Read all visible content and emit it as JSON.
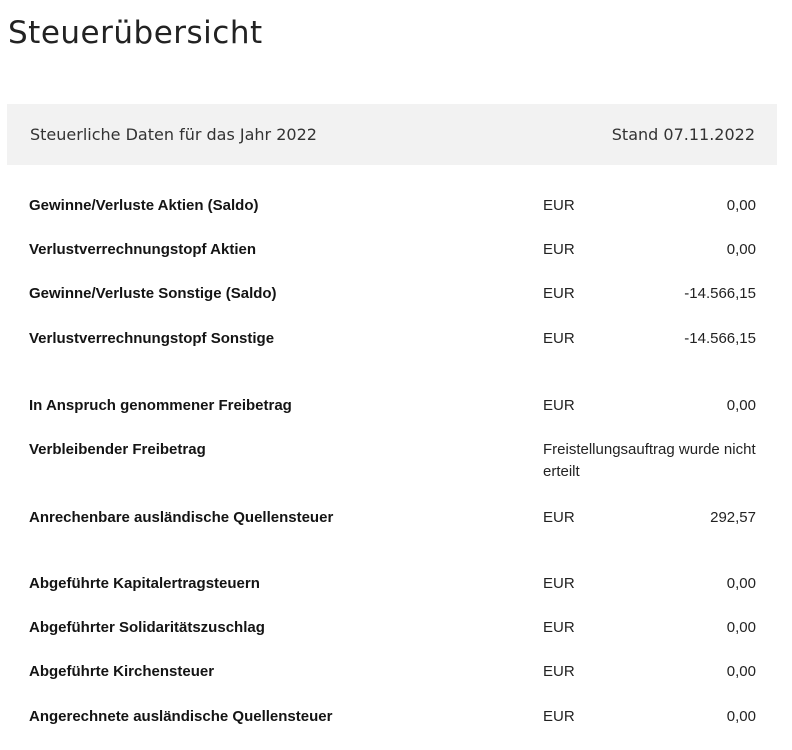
{
  "page": {
    "title": "Steuerübersicht"
  },
  "header": {
    "left": "Steuerliche Daten für das Jahr 2022",
    "right": "Stand 07.11.2022"
  },
  "rows": [
    {
      "label": "Gewinne/Verluste Aktien (Saldo)",
      "currency": "EUR",
      "value": "0,00"
    },
    {
      "label": "Verlustverrechnungstopf Aktien",
      "currency": "EUR",
      "value": "0,00"
    },
    {
      "label": "Gewinne/Verluste Sonstige (Saldo)",
      "currency": "EUR",
      "value": "-14.566,15"
    },
    {
      "label": "Verlustverrechnungstopf Sonstige",
      "currency": "EUR",
      "value": "-14.566,15"
    },
    {
      "label": "In Anspruch genommener Freibetrag",
      "currency": "EUR",
      "value": "0,00"
    },
    {
      "label": "Verbleibender Freibetrag",
      "note": "Freistellungsauftrag wurde nicht erteilt"
    },
    {
      "label": "Anrechenbare ausländische Quellensteuer",
      "currency": "EUR",
      "value": "292,57"
    },
    {
      "label": "Abgeführte Kapitalertragsteuern",
      "currency": "EUR",
      "value": "0,00"
    },
    {
      "label": "Abgeführter Solidaritätszuschlag",
      "currency": "EUR",
      "value": "0,00"
    },
    {
      "label": "Abgeführte Kirchensteuer",
      "currency": "EUR",
      "value": "0,00"
    },
    {
      "label": "Angerechnete ausländische Quellensteuer",
      "currency": "EUR",
      "value": "0,00"
    }
  ]
}
